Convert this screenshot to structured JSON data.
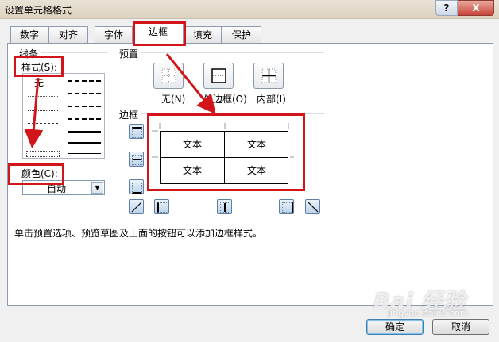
{
  "window": {
    "title": "设置单元格格式",
    "help_label": "?",
    "close_label": "X"
  },
  "tabs": [
    {
      "label": "数字"
    },
    {
      "label": "对齐"
    },
    {
      "label": "字体"
    },
    {
      "label": "边框",
      "active": true
    },
    {
      "label": "填充"
    },
    {
      "label": "保护"
    }
  ],
  "line": {
    "group_label": "线条",
    "style_label": "样式(S):",
    "none_label": "无",
    "color_label": "颜色(C):",
    "color_value": "自动"
  },
  "presets": {
    "group_label": "预置",
    "items": [
      {
        "label": "无(N)",
        "icon": "no-border-icon"
      },
      {
        "label": "外边框(O)",
        "icon": "outline-border-icon"
      },
      {
        "label": "内部(I)",
        "icon": "inside-border-icon"
      }
    ]
  },
  "border": {
    "group_label": "边框",
    "cell_text": [
      "文本",
      "文本",
      "文本",
      "文本"
    ]
  },
  "hint": "单击预置选项、预览草图及上面的按钮可以添加边框样式。",
  "buttons": {
    "ok": "确定",
    "cancel": "取消"
  },
  "watermark": {
    "main": "Bai 经验",
    "sub": "jingyan.baidu.com"
  },
  "colors": {
    "annotation_red": "#d2151b",
    "tab_border": "#8b9bb0"
  }
}
